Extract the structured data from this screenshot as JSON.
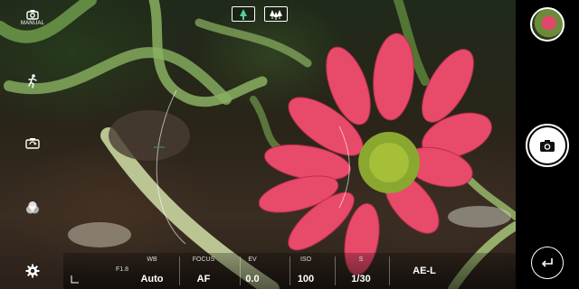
{
  "left_controls": {
    "manual_label": "MANUAL"
  },
  "manual_bar": {
    "aperture": "F1.8",
    "wb": {
      "label": "WB",
      "value": "Auto"
    },
    "focus": {
      "label": "FOCUS",
      "value": "AF"
    },
    "ev": {
      "label": "EV",
      "value": "0.0"
    },
    "iso": {
      "label": "ISO",
      "value": "100"
    },
    "shutter": {
      "label": "S",
      "value": "1/30"
    },
    "ael": {
      "value": "AE-L"
    }
  },
  "icons": {
    "top_toggles": [
      "single-tree-icon",
      "forest-icon"
    ],
    "left": [
      "camera-mode-icon",
      "runner-icon",
      "flip-camera-icon",
      "filter-circles-icon",
      "settings-gear-icon"
    ],
    "right": [
      "gallery-thumbnail",
      "camera-shutter-icon",
      "back-icon"
    ]
  },
  "colors": {
    "flower": "#e84a6a",
    "flower_center": "#8aa830",
    "foliage": "#7fa35a"
  }
}
